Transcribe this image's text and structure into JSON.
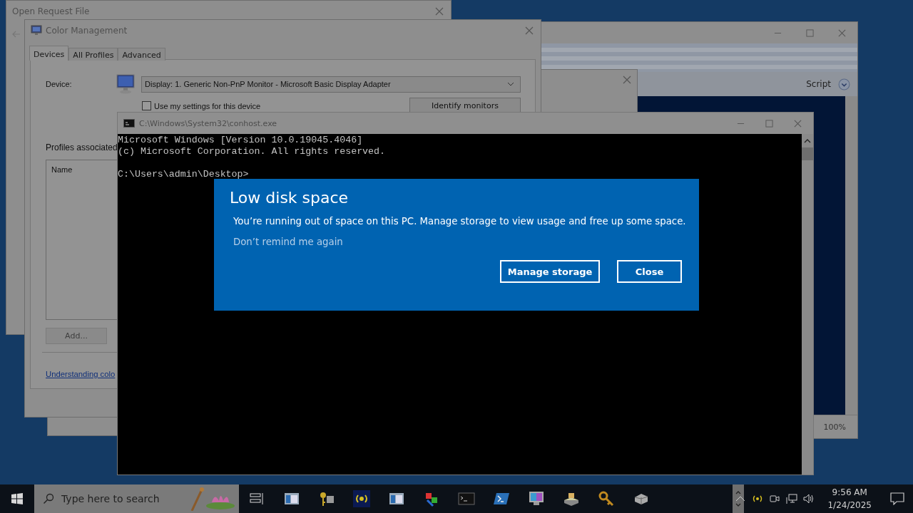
{
  "open_request_window": {
    "title": "Open Request File"
  },
  "background_window": {
    "toolbar_label": "Script",
    "zoom": "100%"
  },
  "color_management": {
    "title": "Color Management",
    "tabs": [
      {
        "label": "Devices",
        "selected": true
      },
      {
        "label": "All Profiles",
        "selected": false
      },
      {
        "label": "Advanced",
        "selected": false
      }
    ],
    "device_label": "Device:",
    "device_value": "Display: 1. Generic Non-PnP Monitor - Microsoft Basic Display Adapter",
    "use_settings": {
      "label": "Use my settings for this device",
      "checked": false
    },
    "identify_button": "Identify monitors",
    "profiles_label": "Profiles associated",
    "list_header": "Name",
    "add_button": {
      "label": "Add...",
      "disabled": true
    },
    "link": "Understanding colo"
  },
  "console": {
    "title": "C:\\Windows\\System32\\conhost.exe",
    "lines": [
      "Microsoft Windows [Version 10.0.19045.4046]",
      "(c) Microsoft Corporation. All rights reserved."
    ],
    "prompt": "C:\\Users\\admin\\Desktop>"
  },
  "notification": {
    "title": "Low disk space",
    "message": "You’re running out of space on this PC. Manage storage to view usage and free up some space.",
    "link": "Don’t remind me again",
    "buttons": [
      "Manage storage",
      "Close"
    ]
  },
  "taskbar": {
    "search_placeholder": "Type here to search",
    "time": "9:56 AM",
    "date": "1/24/2025"
  }
}
